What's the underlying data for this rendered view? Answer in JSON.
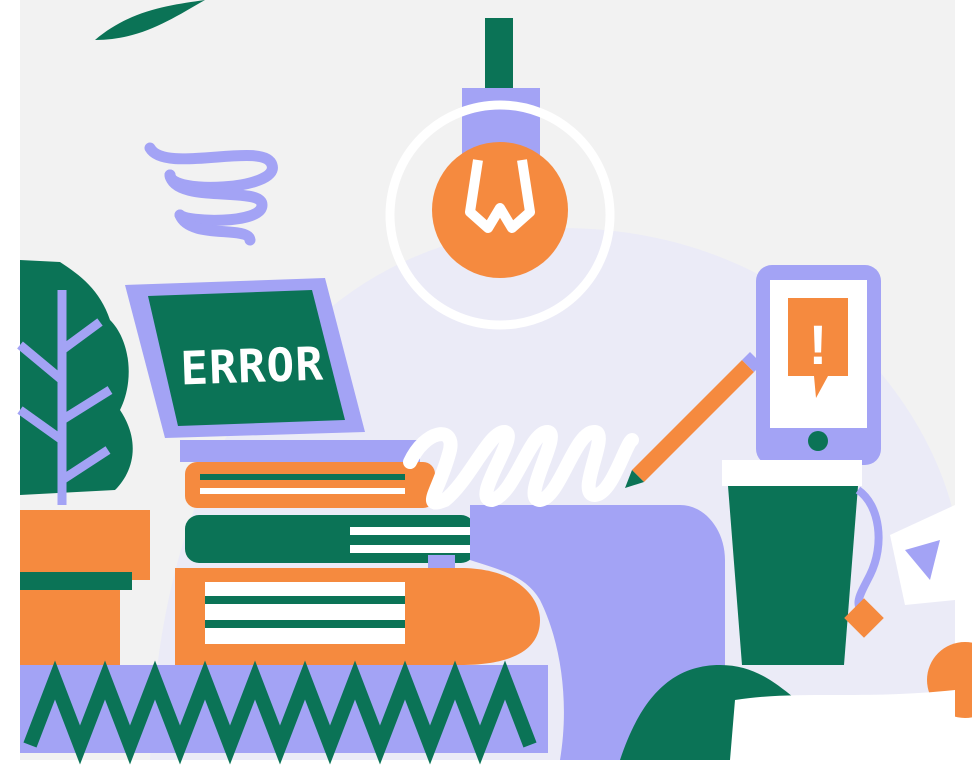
{
  "illustration": {
    "laptop_screen_text": "ERROR",
    "phone_alert_symbol": "!"
  },
  "palette": {
    "background": "#f2f2f2",
    "dome": "#ebebf7",
    "green": "#0b7356",
    "orange": "#f58a3f",
    "lavender": "#a3a3f5",
    "white": "#ffffff"
  },
  "icons": [
    "light-bulb-icon",
    "spring-coil-icon",
    "laptop-icon",
    "smartphone-icon",
    "alert-icon",
    "pencil-icon",
    "potted-plant-icon",
    "book-stack-icon",
    "coffee-cup-icon"
  ]
}
